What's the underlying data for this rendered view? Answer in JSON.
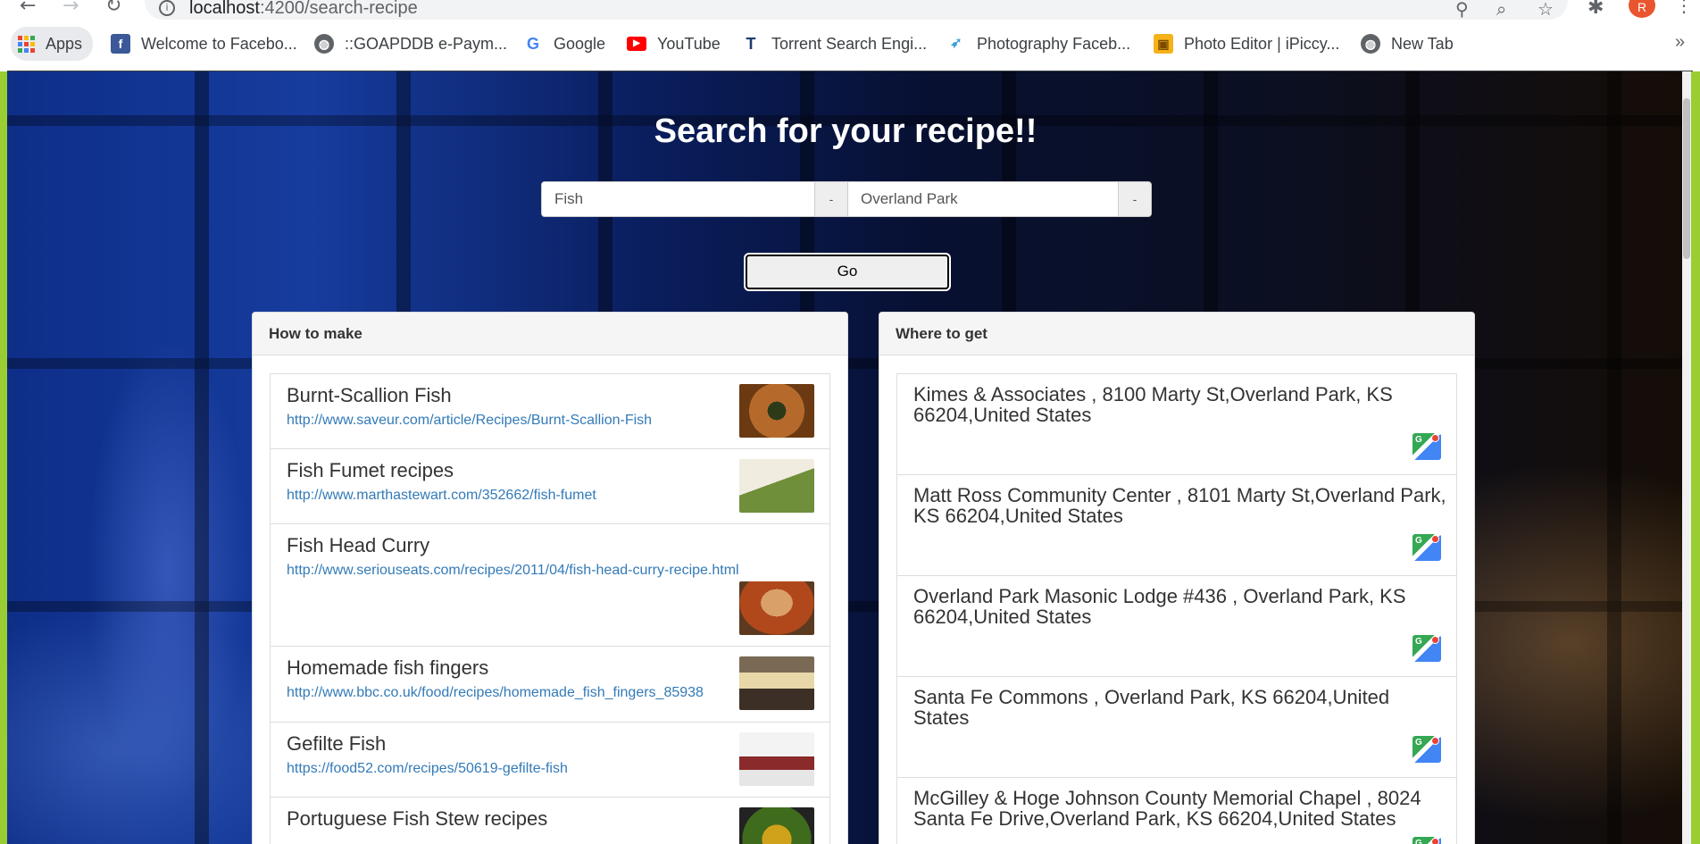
{
  "browser": {
    "url_host": "localhost",
    "url_rest": ":4200/search-recipe",
    "bookmarks": [
      {
        "label": "Apps",
        "icon": "apps-grid-icon"
      },
      {
        "label": "Welcome to Facebo...",
        "icon": "facebook-icon"
      },
      {
        "label": "::GOAPDDB e-Paym...",
        "icon": "globe-icon"
      },
      {
        "label": "Google",
        "icon": "google-icon"
      },
      {
        "label": "YouTube",
        "icon": "youtube-icon"
      },
      {
        "label": "Torrent Search Engi...",
        "icon": "torrentz-icon"
      },
      {
        "label": "Photography Faceb...",
        "icon": "bird-icon"
      },
      {
        "label": "Photo Editor | iPiccy...",
        "icon": "ipiccy-icon"
      },
      {
        "label": "New Tab",
        "icon": "globe-icon"
      }
    ],
    "more_label": "»",
    "profile_initial": "R"
  },
  "search": {
    "heading": "Search for your recipe!!",
    "query": "Fish",
    "location": "Overland Park",
    "addon_label": "-",
    "go_label": "Go"
  },
  "recipes": {
    "title": "How to make",
    "items": [
      {
        "name": "Burnt-Scallion Fish",
        "url": "http://www.saveur.com/article/Recipes/Burnt-Scallion-Fish"
      },
      {
        "name": "Fish Fumet recipes",
        "url": "http://www.marthastewart.com/352662/fish-fumet"
      },
      {
        "name": "Fish Head Curry",
        "url": "http://www.seriouseats.com/recipes/2011/04/fish-head-curry-recipe.html"
      },
      {
        "name": "Homemade fish fingers",
        "url": "http://www.bbc.co.uk/food/recipes/homemade_fish_fingers_85938"
      },
      {
        "name": "Gefilte Fish",
        "url": "https://food52.com/recipes/50619-gefilte-fish"
      },
      {
        "name": "Portuguese Fish Stew recipes",
        "url": ""
      }
    ]
  },
  "places": {
    "title": "Where to get",
    "items": [
      {
        "text": "Kimes & Associates , 8100 Marty St,Overland Park, KS 66204,United States"
      },
      {
        "text": "Matt Ross Community Center , 8101 Marty St,Overland Park, KS 66204,United States"
      },
      {
        "text": "Overland Park Masonic Lodge #436 , Overland Park, KS 66204,United States"
      },
      {
        "text": "Santa Fe Commons , Overland Park, KS 66204,United States"
      },
      {
        "text": "McGilley & Hoge Johnson County Memorial Chapel , 8024 Santa Fe Drive,Overland Park, KS 66204,United States"
      }
    ]
  },
  "colors": {
    "link": "#337ab7",
    "accent_green": "#9acd32"
  }
}
